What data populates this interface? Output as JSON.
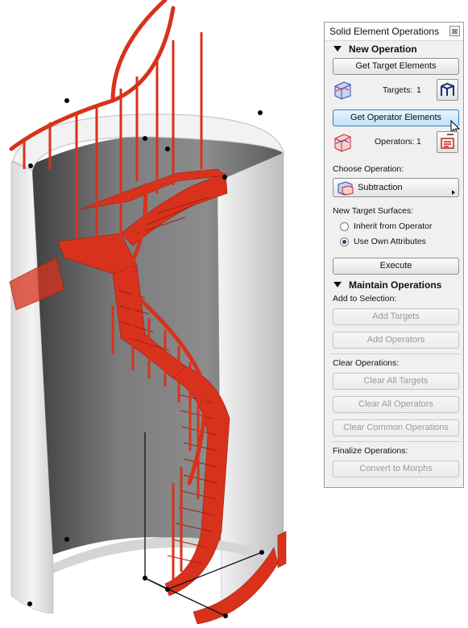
{
  "panel": {
    "title": "Solid Element Operations",
    "close_glyph": "⊠",
    "new_operation": {
      "heading": "New Operation",
      "get_targets_label": "Get Target Elements",
      "targets_label": "Targets:",
      "targets_count": "1",
      "get_operators_label": "Get Operator Elements",
      "operators_label": "Operators:",
      "operators_count": "1",
      "choose_operation_label": "Choose Operation:",
      "operation_value": "Subtraction",
      "surfaces_label": "New Target Surfaces:",
      "surface_options": [
        "Inherit from Operator",
        "Use Own Attributes"
      ],
      "surface_selected": "Use Own Attributes",
      "execute_label": "Execute"
    },
    "maintain": {
      "heading": "Maintain Operations",
      "add_to_selection_label": "Add to Selection:",
      "add_targets_label": "Add Targets",
      "add_operators_label": "Add Operators",
      "clear_operations_label": "Clear Operations:",
      "clear_targets_label": "Clear All Targets",
      "clear_operators_label": "Clear All Operators",
      "clear_common_label": "Clear Common Operations",
      "finalize_label": "Finalize Operations:",
      "convert_label": "Convert to Morphs"
    }
  },
  "icons": [
    "target-elements-icon",
    "operator-elements-icon",
    "subtraction-icon",
    "close-icon",
    "mouse-cursor-icon"
  ],
  "colors": {
    "stair": "#d8321c",
    "wall_dark": "#6a6a6a",
    "wall_light": "#e8e8e8",
    "highlight": "#bfe3fa"
  }
}
